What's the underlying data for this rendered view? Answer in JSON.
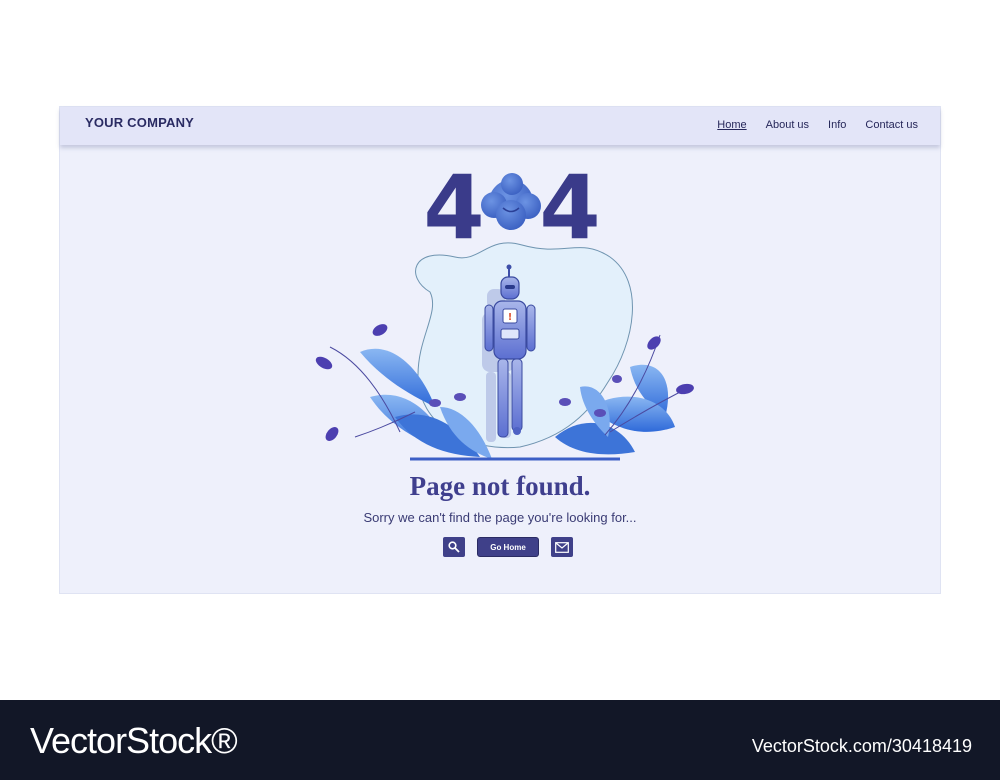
{
  "header": {
    "brand": "YOUR COMPANY",
    "nav": [
      {
        "label": "Home",
        "active": true
      },
      {
        "label": "About us"
      },
      {
        "label": "Info"
      },
      {
        "label": "Contact us"
      }
    ]
  },
  "hero": {
    "code_left": "4",
    "code_right": "4"
  },
  "main": {
    "title": "Page not found.",
    "subtitle": "Sorry we can't find the page you're looking for...",
    "go_home_label": "Go Home",
    "search_icon": "search-icon",
    "mail_icon": "mail-icon"
  },
  "watermark": {
    "logo": "VectorStock®",
    "id": "VectorStock.com/30418419"
  },
  "colors": {
    "primary": "#3f4089",
    "navy": "#2a2b63",
    "background": "#eef0fb",
    "leaf_blue": "#3f7de0",
    "accent_purple": "#5a4fb8"
  }
}
